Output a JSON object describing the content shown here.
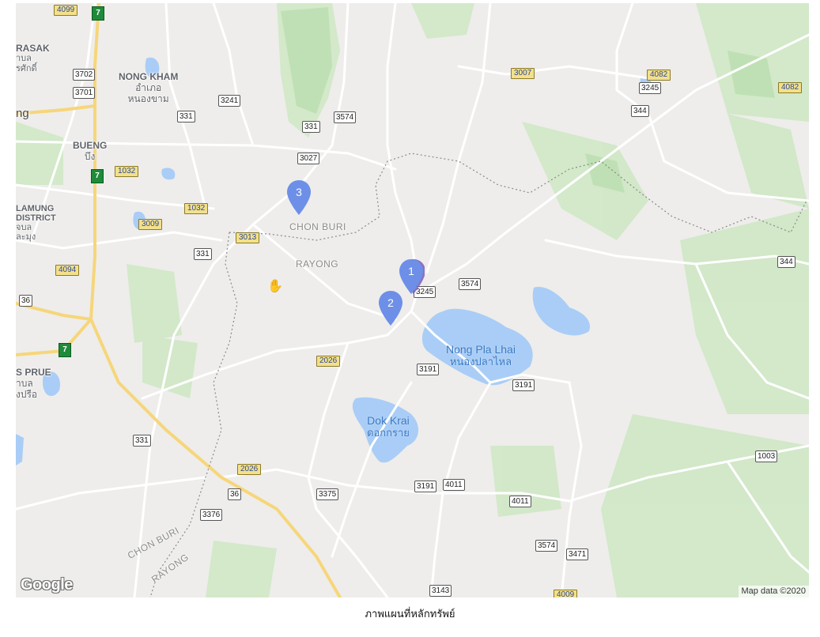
{
  "map": {
    "provider_logo": "Google",
    "attribution": "Map data ©2020",
    "places": {
      "rasak": "RASAK",
      "rasak_th": "จ้าบล\nรศักดิ์",
      "nong_kham": "NONG KHAM",
      "nong_kham_th1": "อำเภอ",
      "nong_kham_th2": "หนองขาม",
      "ng": "ng",
      "bueng": "BUENG",
      "bueng_th": "บึง",
      "lamung": "LAMUNG",
      "district": "DISTRICT",
      "lamung_th1": "จบล",
      "lamung_th2": "ละมุง",
      "s_prue": "S PRUE",
      "s_prue_th1": "าบล",
      "s_prue_th2": "งปรือ"
    },
    "provinces": {
      "chon_buri": "CHON BURI",
      "rayong": "RAYONG",
      "chon_buri_sw": "CHON BURI",
      "rayong_sw": "RAYONG"
    },
    "lakes": {
      "nong_pla_lhai": "Nong Pla Lhai",
      "nong_pla_lhai_th": "หนองปลาไหล",
      "dok_krai": "Dok Krai",
      "dok_krai_th": "ดอกกราย"
    },
    "route_shields_white": [
      "3702",
      "3701",
      "3241",
      "331",
      "331",
      "3574",
      "3027",
      "3245",
      "344",
      "331",
      "344",
      "3574",
      "3245",
      "36",
      "3191",
      "3191",
      "331",
      "36",
      "3375",
      "3191",
      "4011",
      "4011",
      "1003",
      "3376",
      "3574",
      "3471",
      "3143"
    ],
    "route_shields_green": [
      "4099",
      "3007",
      "4082",
      "4082",
      "1032",
      "1032",
      "3009",
      "3013",
      "4094",
      "2026",
      "2026",
      "4009"
    ],
    "highway_shields": [
      "7",
      "7",
      "7"
    ],
    "markers": [
      {
        "label": "1",
        "color": "#6d8fe8"
      },
      {
        "label": "2",
        "color": "#6d8fe8"
      },
      {
        "label": "3",
        "color": "#6d8fe8"
      }
    ],
    "cursor_icon": "grab-hand-icon"
  },
  "caption": "ภาพแผนที่หลักทรัพย์"
}
